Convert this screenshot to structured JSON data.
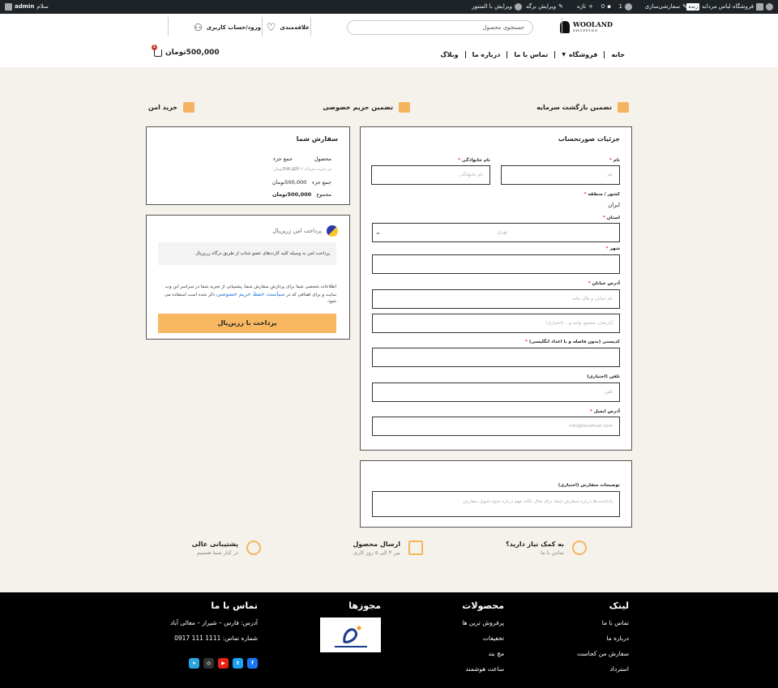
{
  "adminbar": {
    "site_name": "فروشگاه لباس مردانه",
    "live_badge": "زنده",
    "customize": "سفارشی‌سازی",
    "comments_count": "1",
    "updates_count": "0",
    "new": "تازه",
    "edit_page": "ویرایش برگه",
    "edit_elementor": "ویرایش با المنتور",
    "greeting": "سلام",
    "username": "admin"
  },
  "header": {
    "logo_text": "WOOLAND",
    "logo_sub": "SHOPPING",
    "search_placeholder": "جستجوی محصول",
    "wishlist": "علاقه‌مندی",
    "account": "ورود/حساب کاربری",
    "nav": [
      "خانه",
      "فروشگاه",
      "تماس با ما",
      "درباره ما",
      "وبلاگ"
    ],
    "cart_badge": "1",
    "cart_total": "500,000تومان"
  },
  "features": [
    {
      "label": "تضمین بازگشت سرمایه",
      "icon": "thumbs-up-icon"
    },
    {
      "label": "تضمین حریم خصوصی",
      "icon": "lock-icon"
    },
    {
      "label": "خرید امن",
      "icon": "credit-card-icon"
    }
  ],
  "billing": {
    "title": "جزئیات صورتحساب",
    "first_name_label": "نام",
    "first_name_ph": "نام",
    "last_name_label": "نام خانوادگی",
    "last_name_ph": "نام خانوادگی",
    "country_label": "کشور / منطقه",
    "country_value": "ایران",
    "state_label": "استان",
    "state_value": "تهران",
    "city_label": "شهر",
    "address_label": "آدرس خیابان",
    "address1_ph": "نام خیابان و پلاک خانه",
    "address2_ph": "آپارتمان، مجتمع، واحد و... (اختیاری)",
    "postcode_label": "کدپستی (بدون فاصله و با اعداد انگلیسی)",
    "phone_label": "تلفن (اختیاری)",
    "phone_ph": "تلفن",
    "email_label": "آدرس ایمیل",
    "email_ph": "info@localhost.com"
  },
  "notes": {
    "label": "توضیحات سفارش (اختیاری)",
    "placeholder": "یادداشت‌ها درباره سفارش شما، برای مثال نکات مهم درباره نحوه تحویل سفارش"
  },
  "order": {
    "title": "سفارش شما",
    "product_header": "محصول",
    "subtotal_header": "جمع جزء",
    "product_name": "تی شرت مردانه ۲ - آبی × ۱",
    "product_price": "500,000تومان",
    "subtotal_label": "جمع جزء",
    "subtotal_value": "500,000تومان",
    "total_label": "مجموع",
    "total_value": "500,000تومان"
  },
  "payment": {
    "method": "پرداخت امن زرین‌پال",
    "description": "پرداخت امن به وسیله کلیه کارت‌های عضو شتاب از طریق درگاه زرین‌پال",
    "privacy_text": "اطلاعات شخصی شما برای پردازش سفارش شما، پشتیبانی از تجربه شما در سراسر این وب سایت و برای اهدافی که در",
    "privacy_link": "سیاست حفظ حریم خصوصی",
    "privacy_text_end": "ذکر شده است استفاده می شود.",
    "button": "پرداخت با زرین‌پال"
  },
  "bottom_features": [
    {
      "title": "به کمک نیاز دارید؟",
      "sub": "تماس با ما",
      "icon": "chat-icon"
    },
    {
      "title": "ارسال محصول",
      "sub": "بین ۳ الی ۵ روز کاری",
      "icon": "box-icon"
    },
    {
      "title": "پشتیبانی عالی",
      "sub": "در کنار شما هستیم",
      "icon": "headset-icon"
    }
  ],
  "footer": {
    "links_title": "لینک",
    "links": [
      "تماس با ما",
      "درباره ما",
      "سفارش من کجاست",
      "استرداد"
    ],
    "products_title": "محصولات",
    "products": [
      "پرفروش ترین ها",
      "تخفیفات",
      "مچ بند",
      "ساعت هوشمند"
    ],
    "licenses_title": "مجوزها",
    "contact_title": "تماس با ما",
    "address": "آدرس: فارس – شیراز – معالی آباد",
    "phone": "شماره تماس: 1111 111 0917",
    "social": [
      {
        "name": "facebook-icon",
        "glyph": "f",
        "color": "#1877f2"
      },
      {
        "name": "twitter-icon",
        "glyph": "t",
        "color": "#1da1f2"
      },
      {
        "name": "youtube-icon",
        "glyph": "▶",
        "color": "#e62117"
      },
      {
        "name": "instagram-icon",
        "glyph": "◎",
        "color": "#333333"
      },
      {
        "name": "telegram-icon",
        "glyph": "➤",
        "color": "#2ca5e0"
      }
    ]
  }
}
